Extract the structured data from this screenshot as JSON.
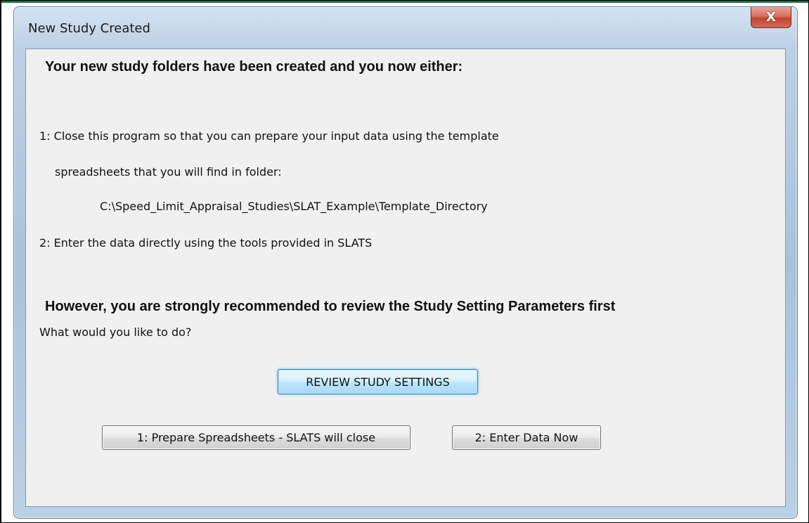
{
  "window": {
    "title": "New Study Created",
    "close_glyph": "X"
  },
  "content": {
    "heading": "Your new study folders have been created and you now either:",
    "option1_line1": "1: Close this program so that you can prepare your input data using the template",
    "option1_line2": "spreadsheets that you will find in folder:",
    "folder_path": "C:\\Speed_Limit_Appraisal_Studies\\SLAT_Example\\Template_Directory",
    "option2_line": "2: Enter the data directly using the tools provided in SLATS",
    "recommendation": "However, you are strongly recommended to review the Study Setting Parameters first",
    "question": "What would you like to do?"
  },
  "buttons": {
    "review": "REVIEW STUDY SETTINGS",
    "prepare": "1: Prepare Spreadsheets - SLATS will close",
    "enter": "2: Enter Data Now"
  },
  "icons": {
    "close": "close-icon"
  },
  "colors": {
    "window_frame": "#a9c2dc",
    "client_bg": "#f0f0f0",
    "close_button": "#c24530",
    "focused_button": "#bee6fd",
    "top_strip": "#1e6b4a"
  }
}
